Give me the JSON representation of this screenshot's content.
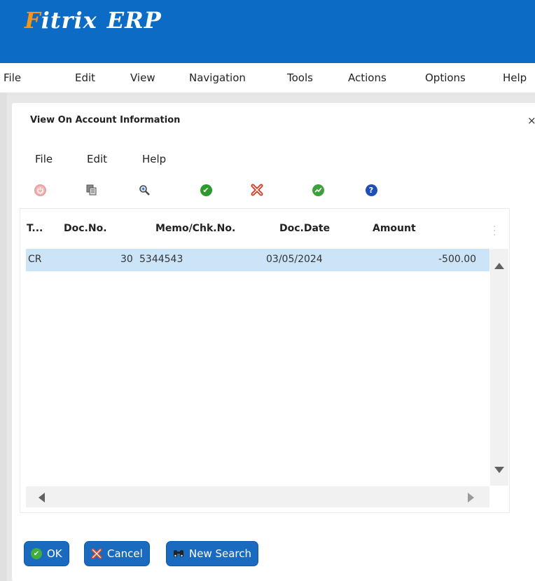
{
  "app": {
    "logo_text": "Fitrix",
    "logo_suffix": "ERP",
    "brand_color": "#0c6cc5",
    "logo_accent": "#f7941d"
  },
  "menu": [
    "File",
    "Edit",
    "View",
    "Navigation",
    "Tools",
    "Actions",
    "Options",
    "Help"
  ],
  "dialog": {
    "title": "View On Account Information",
    "close": "×",
    "menu": [
      "File",
      "Edit",
      "Help"
    ],
    "toolbar": [
      "power-icon",
      "copy-pages-icon",
      "zoom-search-icon",
      "accept-check-icon",
      "cancel-x-icon",
      "refresh-chart-icon",
      "help-icon"
    ],
    "table": {
      "columns": [
        "T...",
        "Doc.No.",
        "Memo/Chk.No.",
        "Doc.Date",
        "Amount"
      ],
      "rows": [
        {
          "type": "CR",
          "doc_no": "30",
          "memo": "5344543",
          "date": "03/05/2024",
          "amount": "-500.00"
        }
      ],
      "selected_row_color": "#cce4f7"
    },
    "buttons": {
      "ok": "OK",
      "cancel": "Cancel",
      "new_search": "New Search"
    }
  }
}
